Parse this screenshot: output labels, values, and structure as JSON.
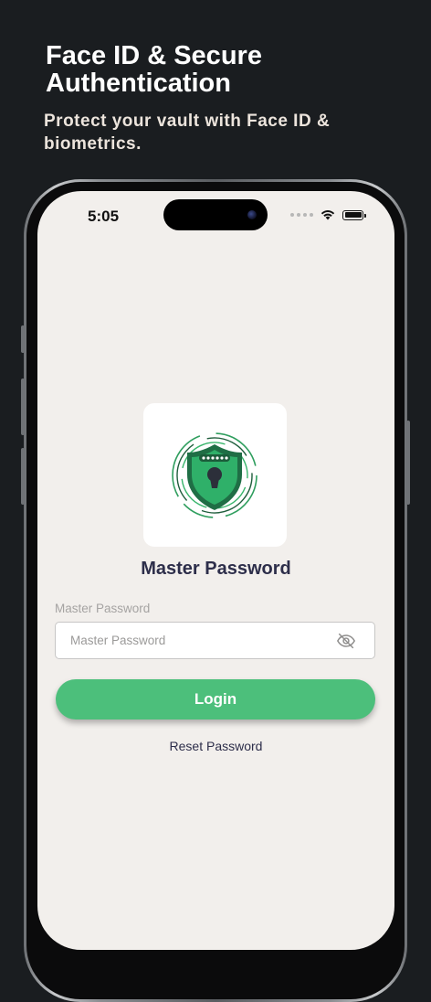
{
  "promo": {
    "title": "Face ID & Secure Authentication",
    "subtitle": "Protect your vault with Face ID & biometrics."
  },
  "status_bar": {
    "time": "5:05",
    "icons": [
      "signal-dots-icon",
      "wifi-icon",
      "battery-icon"
    ]
  },
  "login": {
    "logo_icon": "shield-keyhole-icon",
    "title": "Master Password",
    "field_label": "Master Password",
    "password_value": "",
    "password_placeholder": "Master Password",
    "visibility_icon": "eye-off-icon",
    "login_label": "Login",
    "reset_label": "Reset Password"
  },
  "colors": {
    "background": "#1a1d20",
    "screen": "#f2efec",
    "accent": "#4cbf7b",
    "shield_dark_green": "#1f7a4a",
    "title_text": "#2d2e4a"
  }
}
